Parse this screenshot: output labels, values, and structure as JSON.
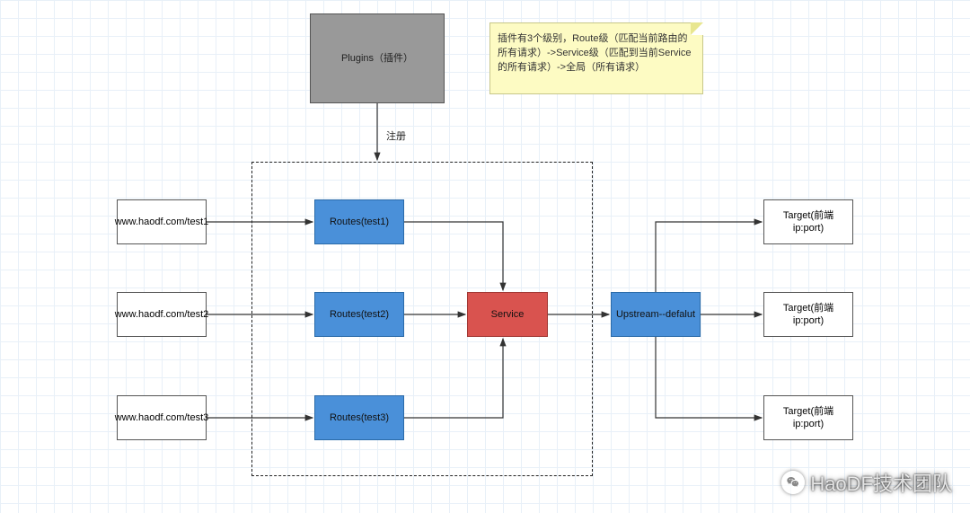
{
  "plugins": {
    "label": "Plugins（插件）"
  },
  "note": {
    "text": "插件有3个级别，Route级（匹配当前路由的所有请求）->Service级（匹配到当前Service的所有请求）->全局（所有请求）"
  },
  "register_label": "注册",
  "urls": [
    {
      "label": "www.haodf.com/test1"
    },
    {
      "label": "www.haodf.com/test2"
    },
    {
      "label": "www.haodf.com/test3"
    }
  ],
  "routes": [
    {
      "label": "Routes(test1)"
    },
    {
      "label": "Routes(test2)"
    },
    {
      "label": "Routes(test3)"
    }
  ],
  "service": {
    "label": "Service"
  },
  "upstream": {
    "label": "Upstream--defalut"
  },
  "targets": [
    {
      "label": "Target(前端ip:port)"
    },
    {
      "label": "Target(前端ip:port)"
    },
    {
      "label": "Target(前端ip:port)"
    }
  ],
  "watermark": {
    "text": "HaoDF技术团队",
    "icon": "wechat-icon"
  }
}
